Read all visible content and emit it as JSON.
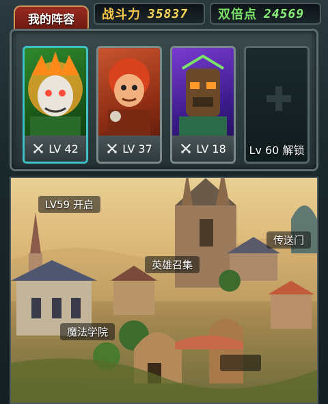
{
  "header": {
    "lineup_tab": "我的阵容",
    "power_label": "战斗力",
    "power_value": "35837",
    "double_label": "双倍点",
    "double_value": "24569"
  },
  "lineup": {
    "heroes": [
      {
        "level": "LV 42",
        "theme": "green"
      },
      {
        "level": "LV 37",
        "theme": "red"
      },
      {
        "level": "LV 18",
        "theme": "purple"
      }
    ],
    "locked_slot_label": "Lv 60 解锁"
  },
  "map": {
    "locations": {
      "lv59_unlock": "LV59 开启",
      "hero_summon": "英雄召集",
      "portal": "传送门",
      "magic_academy": "魔法学院"
    }
  },
  "colors": {
    "power_gold": "#ffd85a",
    "double_green": "#8af07a",
    "tab_red": "#9b2b21"
  }
}
